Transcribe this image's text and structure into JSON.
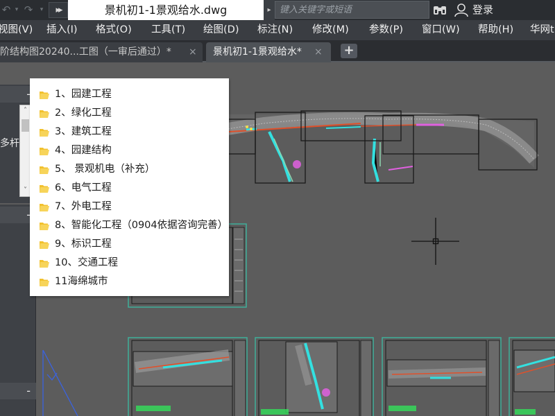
{
  "titlebar": {
    "doc_title": "景机初1-1景观给水.dwg",
    "search_placeholder": "键入关键字或短语",
    "login_label": "登录",
    "overflow_label": "▸▸"
  },
  "menu": [
    "视图(V)",
    "插入(I)",
    "格式(O)",
    "工具(T)",
    "绘图(D)",
    "标注(N)",
    "修改(M)",
    "参数(P)",
    "窗口(W)",
    "帮助(H)",
    "华网t"
  ],
  "tabs": [
    {
      "label": "阶结构图20240...工图（一审后通过）*",
      "close": "×"
    },
    {
      "label": "景机初1-1景观给水*",
      "close": "×"
    }
  ],
  "new_tab": "+",
  "palette": {
    "headers": [
      "-",
      "-",
      "-"
    ],
    "visible_text": "多杆合"
  },
  "folder_list": [
    "1、园建工程",
    "2、绿化工程",
    "3、建筑工程",
    "4、园建结构",
    "5、 景观机电（补充）",
    "6、电气工程",
    "7、外电工程",
    "8、智能化工程（0904依据咨询完善）",
    "9、标识工程",
    "10、交通工程",
    "11海绵城市"
  ],
  "colors": {
    "canvas": "#5c5c5c",
    "titlebar": "#2a2d31",
    "menubar": "#3a3d42",
    "folder": "#f2c12e",
    "viewport_frame": "#1a1a1a",
    "sheet_frame": "#3fae9a",
    "crosshair": "#1a1a1a"
  }
}
